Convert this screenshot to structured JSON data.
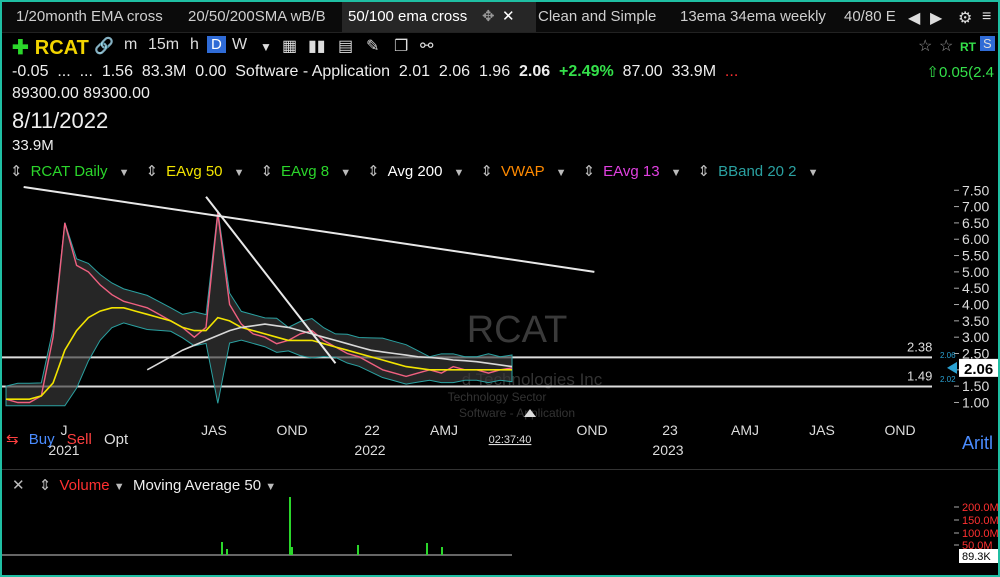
{
  "tabs": [
    "1/20month EMA cross",
    "20/50/200SMA wB/B",
    "50/100 ema cross",
    "Clean and Simple",
    "13ema 34ema weekly",
    "40/80 E"
  ],
  "active_tab": 2,
  "toolbar": {
    "symbol": "RCAT",
    "intervals": [
      "m",
      "15m",
      "h",
      "D",
      "W"
    ],
    "active_interval": "D",
    "rt_label": "RT",
    "s_label": "S"
  },
  "quote": {
    "change": "-0.05",
    "dots": "...",
    "dots2": "...",
    "open": "1.56",
    "volume": "83.3M",
    "zero": "0.00",
    "sector": "Software - Application",
    "v1": "2.01",
    "v2": "2.06",
    "v3": "1.96",
    "last": "2.06",
    "pct": "+2.49%",
    "v4": "87.00",
    "v5": "33.9M",
    "v6": "...",
    "line2": "89300.00  89300.00",
    "date": "8/11/2022",
    "bar_volume": "33.9M",
    "topright": "0.05(2.4"
  },
  "legend": [
    {
      "label": "RCAT Daily",
      "color": "#2bd62b"
    },
    {
      "label": "EAvg 50",
      "color": "#f2e400"
    },
    {
      "label": "EAvg 8",
      "color": "#2bd62b"
    },
    {
      "label": "Avg 200",
      "color": "#ffffff"
    },
    {
      "label": "VWAP",
      "color": "#ff8a00"
    },
    {
      "label": "EAvg 13",
      "color": "#e040e0"
    },
    {
      "label": "BBand 20 2",
      "color": "#2aa1a1"
    }
  ],
  "chart_data": {
    "type": "line",
    "symbol_watermark": "RCAT",
    "watermark_lines": [
      "d Technologies Inc",
      "Technology Sector",
      "Software - Application"
    ],
    "y_ticks": [
      "7.50",
      "7.00",
      "6.50",
      "6.00",
      "5.50",
      "5.00",
      "4.50",
      "4.00",
      "3.50",
      "3.00",
      "2.50",
      "2.00",
      "1.50",
      "1.00"
    ],
    "ylim": [
      0.8,
      7.6
    ],
    "x_labels": [
      "J",
      "JAS",
      "OND",
      "22",
      "AMJ",
      "OND",
      "23",
      "AMJ",
      "JAS",
      "OND"
    ],
    "year_labels": [
      "2021",
      "2022",
      "2023"
    ],
    "horizontal_levels": [
      2.38,
      1.49
    ],
    "level_labels": [
      "2.38",
      "1.49"
    ],
    "price_tag": "2.06",
    "small_tags": [
      "2.06",
      "2.02"
    ],
    "time_label": "02:37:40",
    "series": [
      {
        "name": "RCAT Daily",
        "color": "#f06080",
        "values": [
          1.1,
          1.0,
          1.0,
          1.2,
          3.0,
          6.5,
          5.2,
          5.0,
          4.6,
          4.3,
          4.1,
          4.0,
          3.9,
          3.7,
          3.5,
          3.3,
          3.0,
          3.3,
          6.8,
          4.0,
          3.4,
          3.1,
          3.0,
          2.8,
          2.9,
          3.1,
          3.2,
          2.9,
          2.7,
          2.5,
          2.4,
          2.2,
          2.0,
          1.9,
          1.8,
          1.9,
          2.0,
          1.9,
          2.1,
          2.0,
          2.0,
          1.9,
          2.0,
          2.06
        ]
      },
      {
        "name": "EAvg 50",
        "color": "#f2e400",
        "values": [
          1.1,
          1.1,
          1.1,
          1.2,
          1.6,
          2.6,
          3.2,
          3.6,
          3.8,
          3.9,
          3.9,
          3.8,
          3.7,
          3.6,
          3.5,
          3.3,
          3.2,
          3.2,
          3.6,
          3.5,
          3.3,
          3.2,
          3.1,
          3.0,
          2.9,
          2.9,
          2.9,
          2.8,
          2.7,
          2.6,
          2.5,
          2.4,
          2.3,
          2.2,
          2.1,
          2.05,
          2.0,
          2.0,
          2.0,
          2.0,
          2.0,
          2.0,
          2.0,
          2.0
        ]
      },
      {
        "name": "Avg 200",
        "color": "#d8d8d8",
        "values": [
          null,
          null,
          null,
          null,
          null,
          null,
          null,
          null,
          null,
          null,
          null,
          null,
          2.0,
          2.2,
          2.4,
          2.6,
          2.75,
          2.9,
          3.05,
          3.2,
          3.3,
          3.35,
          3.4,
          3.35,
          3.3,
          3.2,
          3.1,
          3.0,
          2.9,
          2.8,
          2.7,
          2.6,
          2.55,
          2.5,
          2.45,
          2.4,
          2.38,
          2.35,
          2.3,
          2.28,
          2.25,
          2.2,
          2.15,
          2.1
        ]
      }
    ],
    "trendlines": [
      {
        "from": [
          1.5,
          7.6
        ],
        "to": [
          50,
          5.0
        ]
      },
      {
        "from": [
          17,
          7.3
        ],
        "to": [
          28,
          2.2
        ]
      }
    ]
  },
  "trade": {
    "buy": "Buy",
    "sell": "Sell",
    "opt": "Opt"
  },
  "volume_legend": {
    "label": "Volume",
    "ma": "Moving Average 50"
  },
  "volume_axis": [
    "200.0M",
    "150.0M",
    "100.0M",
    "50.0M"
  ],
  "volume_tag": "89.3K",
  "right_label": "Aritl"
}
